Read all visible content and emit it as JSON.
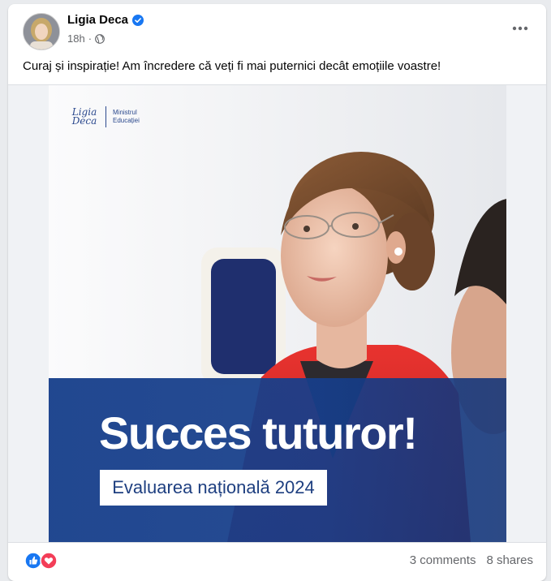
{
  "post": {
    "author": "Ligia Deca",
    "time": "18h",
    "text": "Curaj și inspirație! Am încredere că veți fi mai puternici decât emoțiile voastre!",
    "more_icon": "more-horizontal-icon",
    "privacy_icon": "globe-icon",
    "verified_icon": "verified-badge-icon"
  },
  "poster": {
    "brand_script_line1": "Ligia",
    "brand_script_line2": "Deca",
    "brand_text_line1": "Ministrul",
    "brand_text_line2": "Educației",
    "headline": "Succes tuturor!",
    "subtitle": "Evaluarea națională 2024"
  },
  "footer": {
    "comments": "3 comments",
    "shares": "8 shares",
    "reaction_icons": [
      "like-icon",
      "love-icon"
    ]
  },
  "colors": {
    "banner_blue": "#1a4490",
    "link_blue": "#1877f2",
    "love_red": "#f33e58"
  }
}
